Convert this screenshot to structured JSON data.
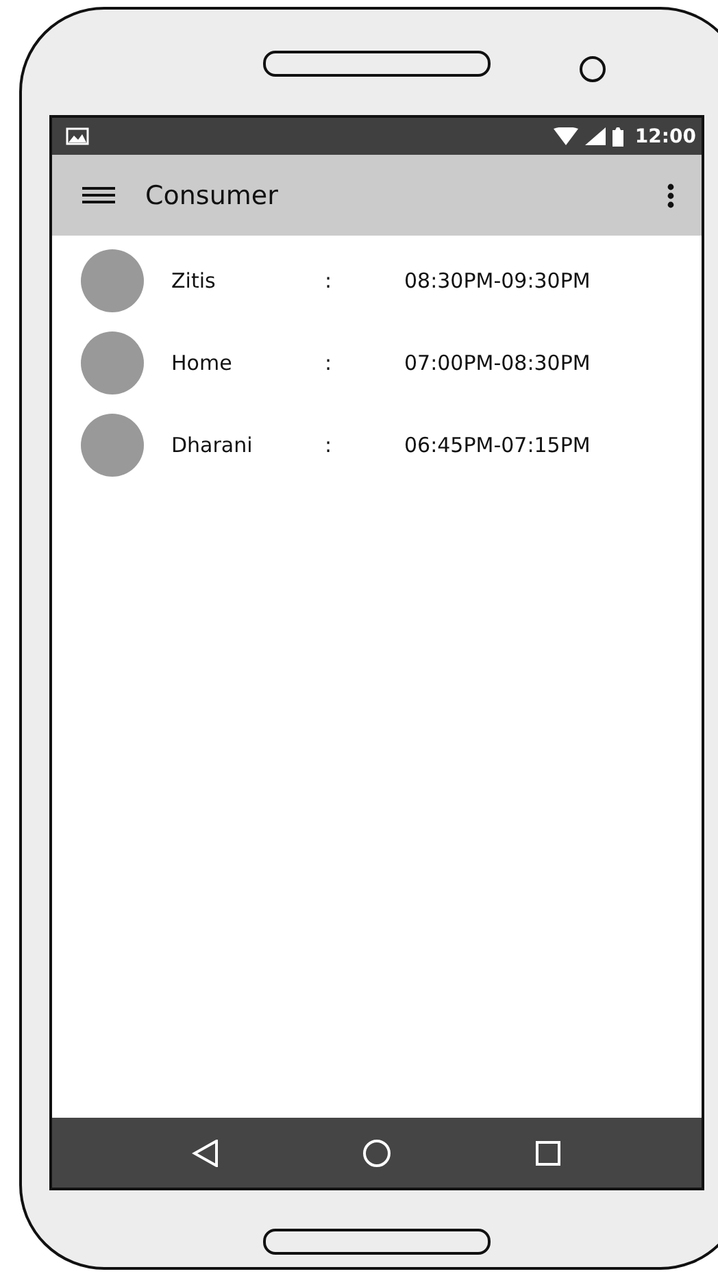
{
  "status_bar": {
    "time": "12:00"
  },
  "app_bar": {
    "title": "Consumer"
  },
  "entries": [
    {
      "name": "Zitis",
      "separator": ":",
      "time": "08:30PM-09:30PM"
    },
    {
      "name": "Home",
      "separator": ":",
      "time": "07:00PM-08:30PM"
    },
    {
      "name": "Dharani",
      "separator": ":",
      "time": "06:45PM-07:15PM"
    }
  ]
}
